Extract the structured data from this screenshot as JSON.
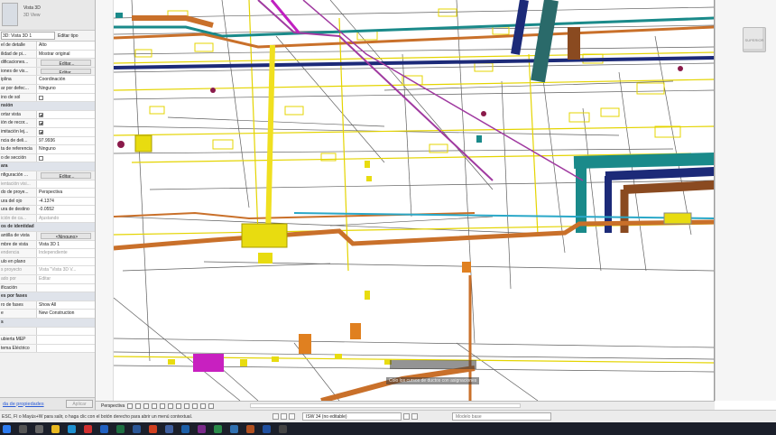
{
  "properties": {
    "type_name": "Vista 3D",
    "type_sub": "3D View",
    "instance_selector": "3D: Vista 3D 1",
    "edit_type_label": "Editar tipo",
    "rows": [
      {
        "kind": "prop",
        "key": "el de detalle",
        "value": "Alto"
      },
      {
        "kind": "prop",
        "key": "ilidad de pi...",
        "value": "Mostrar original"
      },
      {
        "kind": "prop",
        "key": "dificaciones...",
        "value": "Editar...",
        "btn": true
      },
      {
        "kind": "prop",
        "key": "iones de vis...",
        "value": "Editar...",
        "btn": true
      },
      {
        "kind": "prop",
        "key": "iplina",
        "value": "Coordinación"
      },
      {
        "kind": "prop",
        "key": "ar por defec...",
        "value": "Ninguno"
      },
      {
        "kind": "prop",
        "key": "ino de sol",
        "check": false
      },
      {
        "kind": "group",
        "key": "nsión"
      },
      {
        "kind": "prop",
        "key": "ortar vista",
        "check": true
      },
      {
        "kind": "prop",
        "key": "ión de recor...",
        "check": true
      },
      {
        "kind": "prop",
        "key": "imitación lej...",
        "check": true
      },
      {
        "kind": "prop",
        "key": "ncia de deli...",
        "value": "97.9936"
      },
      {
        "kind": "prop",
        "key": "ta de referencia",
        "value": "Ninguno"
      },
      {
        "kind": "prop",
        "key": "o de sección",
        "check": false
      },
      {
        "kind": "group",
        "key": "ara"
      },
      {
        "kind": "prop",
        "key": "nfiguración ...",
        "value": "Editar...",
        "btn": true
      },
      {
        "kind": "prop",
        "key": "ientación visi...",
        "value": "",
        "gray": true
      },
      {
        "kind": "prop",
        "key": "do de proye...",
        "value": "Perspectiva"
      },
      {
        "kind": "prop",
        "key": "ura del ojo",
        "value": "-4.1374"
      },
      {
        "kind": "prop",
        "key": "ura de destino",
        "value": "-0.0552"
      },
      {
        "kind": "prop",
        "key": "ición de ca...",
        "value": "Ajustando",
        "gray": true
      },
      {
        "kind": "group",
        "key": "os de identidad"
      },
      {
        "kind": "prop",
        "key": "antilla de vista",
        "value": "<Ninguno>",
        "btn": true
      },
      {
        "kind": "prop",
        "key": "mbre de vista",
        "value": "Vista 3D 1"
      },
      {
        "kind": "prop",
        "key": "endencia",
        "value": "Independiente",
        "gray": true
      },
      {
        "kind": "prop",
        "key": "ulo en plano",
        "value": ""
      },
      {
        "kind": "prop",
        "key": "s proyecto",
        "value": "Vista \"Vista 3D V...",
        "gray": true
      },
      {
        "kind": "prop",
        "key": "ado por",
        "value": "Editar",
        "gray": true
      },
      {
        "kind": "prop",
        "key": "ificación",
        "value": ""
      },
      {
        "kind": "group",
        "key": "es por fases"
      },
      {
        "kind": "prop",
        "key": "ro de fases",
        "value": "Show All"
      },
      {
        "kind": "prop",
        "key": "e",
        "value": "New Construction"
      },
      {
        "kind": "group",
        "key": "s"
      },
      {
        "kind": "prop",
        "key": "",
        "value": ""
      },
      {
        "kind": "prop",
        "key": "ubierta MEP",
        "value": ""
      },
      {
        "kind": "prop",
        "key": "tema Eléctrico",
        "value": ""
      }
    ],
    "help_link": "da de propiedades",
    "apply_label": "Aplicar"
  },
  "viewport": {
    "tooltip_1": "",
    "tooltip_2": "Colo los cursos de ductos con asignaciones",
    "viewcube_label": "SUPERIOR"
  },
  "view_bar": {
    "scale_label": "Perspectiva"
  },
  "status_bar": {
    "message": "ESC, FI o Mayús+W para salir, o haga clic con el botón derecho para abrir un menú contextual.",
    "workset": "ISW 34 (no editable)",
    "main_model": "Modelo base"
  },
  "colors": {
    "pipe_orange": "#c9702a",
    "duct_teal": "#1a8a8a",
    "duct_navy": "#1c2a78",
    "pipe_magenta": "#c020c0",
    "pipe_yellow": "#f0e020",
    "pipe_brown": "#8a4a20",
    "lines_dark": "#333333"
  }
}
